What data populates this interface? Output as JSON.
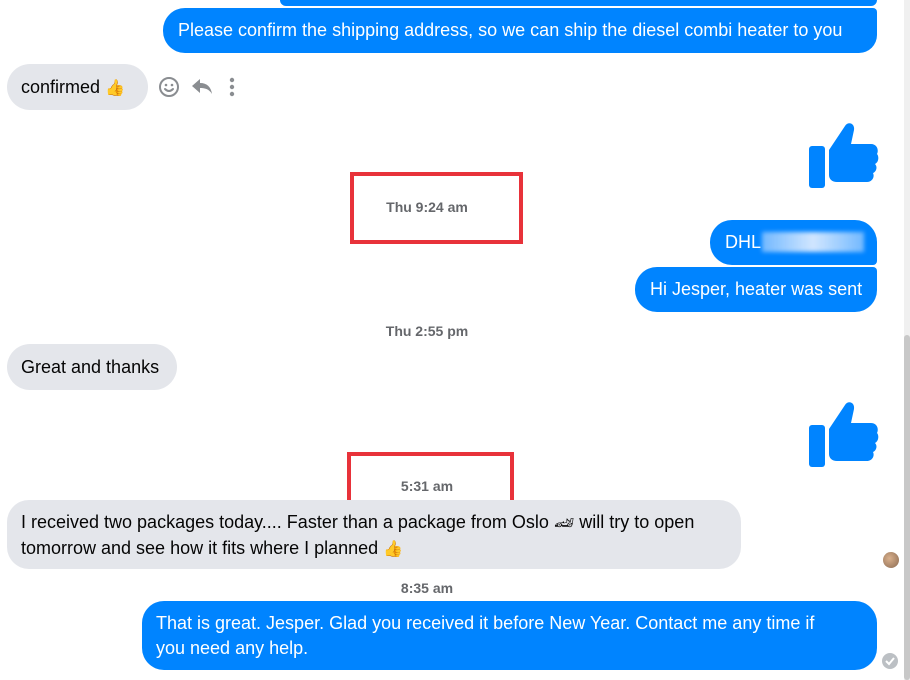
{
  "conversation": {
    "messages": [
      {
        "id": "m1",
        "from": "me",
        "text": "Please confirm the shipping address, so we can ship the diesel combi heater to you"
      },
      {
        "id": "m2",
        "from": "them",
        "text": "confirmed",
        "emoji": "👍"
      },
      {
        "id": "m3",
        "from": "me",
        "type": "like"
      },
      {
        "id": "m4",
        "from": "me",
        "text": "DHL"
      },
      {
        "id": "m5",
        "from": "me",
        "text": "Hi Jesper, heater was sent"
      },
      {
        "id": "m6",
        "from": "them",
        "text": "Great and thanks"
      },
      {
        "id": "m7",
        "from": "me",
        "type": "like"
      },
      {
        "id": "m8",
        "from": "them",
        "line1": "I received two packages today.... Faster than a package from Oslo",
        "line1_emoji": "🏎",
        "line1_rest": "will try to open",
        "line2": "tomorrow and see how it fits where I planned",
        "line2_emoji": "👍"
      },
      {
        "id": "m9",
        "from": "me",
        "line1": "That is great. Jesper. Glad you received it before New Year. Contact me any time if",
        "line2": "you need any help."
      }
    ],
    "timestamps": {
      "t1": "Thu 9:24 am",
      "t2": "Thu 2:55 pm",
      "t3": "5:31 am",
      "t4": "8:35 am"
    }
  },
  "icons": {
    "react": "smiley-icon",
    "reply": "reply-icon",
    "more": "more-icon",
    "like": "thumbs-up-icon",
    "seen": "seen-check-icon"
  },
  "colors": {
    "outgoing": "#0084ff",
    "incoming": "#e4e6eb",
    "highlight": "#e8323a"
  }
}
